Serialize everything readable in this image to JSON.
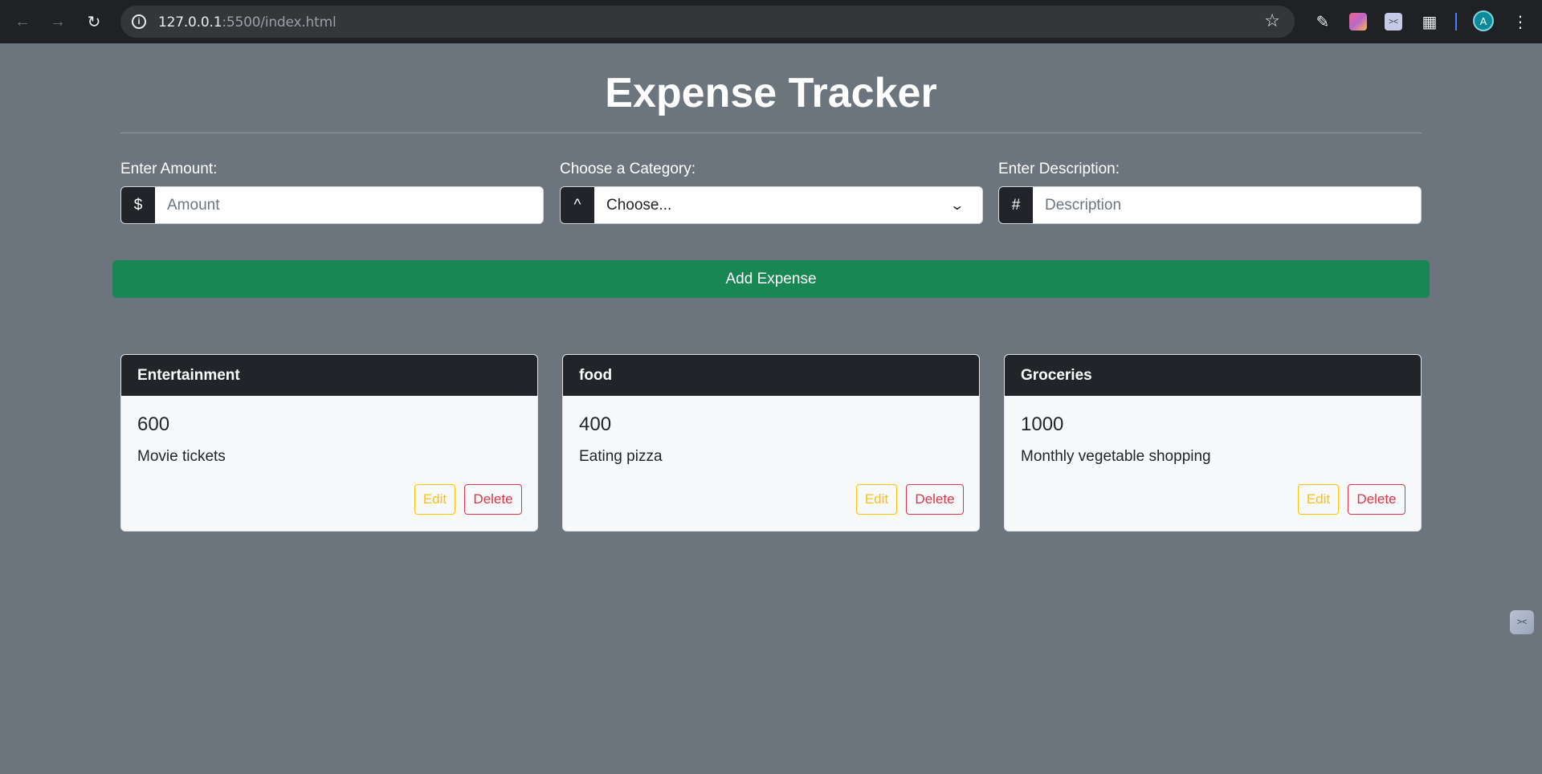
{
  "browser": {
    "url_host": "127.0.0.1",
    "url_rest": ":5500/index.html",
    "avatar_letter": "A"
  },
  "header": {
    "title": "Expense Tracker"
  },
  "form": {
    "amount": {
      "label": "Enter Amount:",
      "addon": "$",
      "placeholder": "Amount"
    },
    "category": {
      "label": "Choose a Category:",
      "addon": "^",
      "selected": "Choose..."
    },
    "description": {
      "label": "Enter Description:",
      "addon": "#",
      "placeholder": "Description"
    },
    "submit_label": "Add Expense"
  },
  "expenses": [
    {
      "category": "Entertainment",
      "amount": "600",
      "description": "Movie tickets",
      "edit_label": "Edit",
      "delete_label": "Delete"
    },
    {
      "category": "food",
      "amount": "400",
      "description": "Eating pizza",
      "edit_label": "Edit",
      "delete_label": "Delete"
    },
    {
      "category": "Groceries",
      "amount": "1000",
      "description": "Monthly vegetable shopping",
      "edit_label": "Edit",
      "delete_label": "Delete"
    }
  ],
  "colors": {
    "background": "#6c757d",
    "success": "#198754",
    "dark": "#212529",
    "warning": "#ffc107",
    "danger": "#dc3545"
  }
}
